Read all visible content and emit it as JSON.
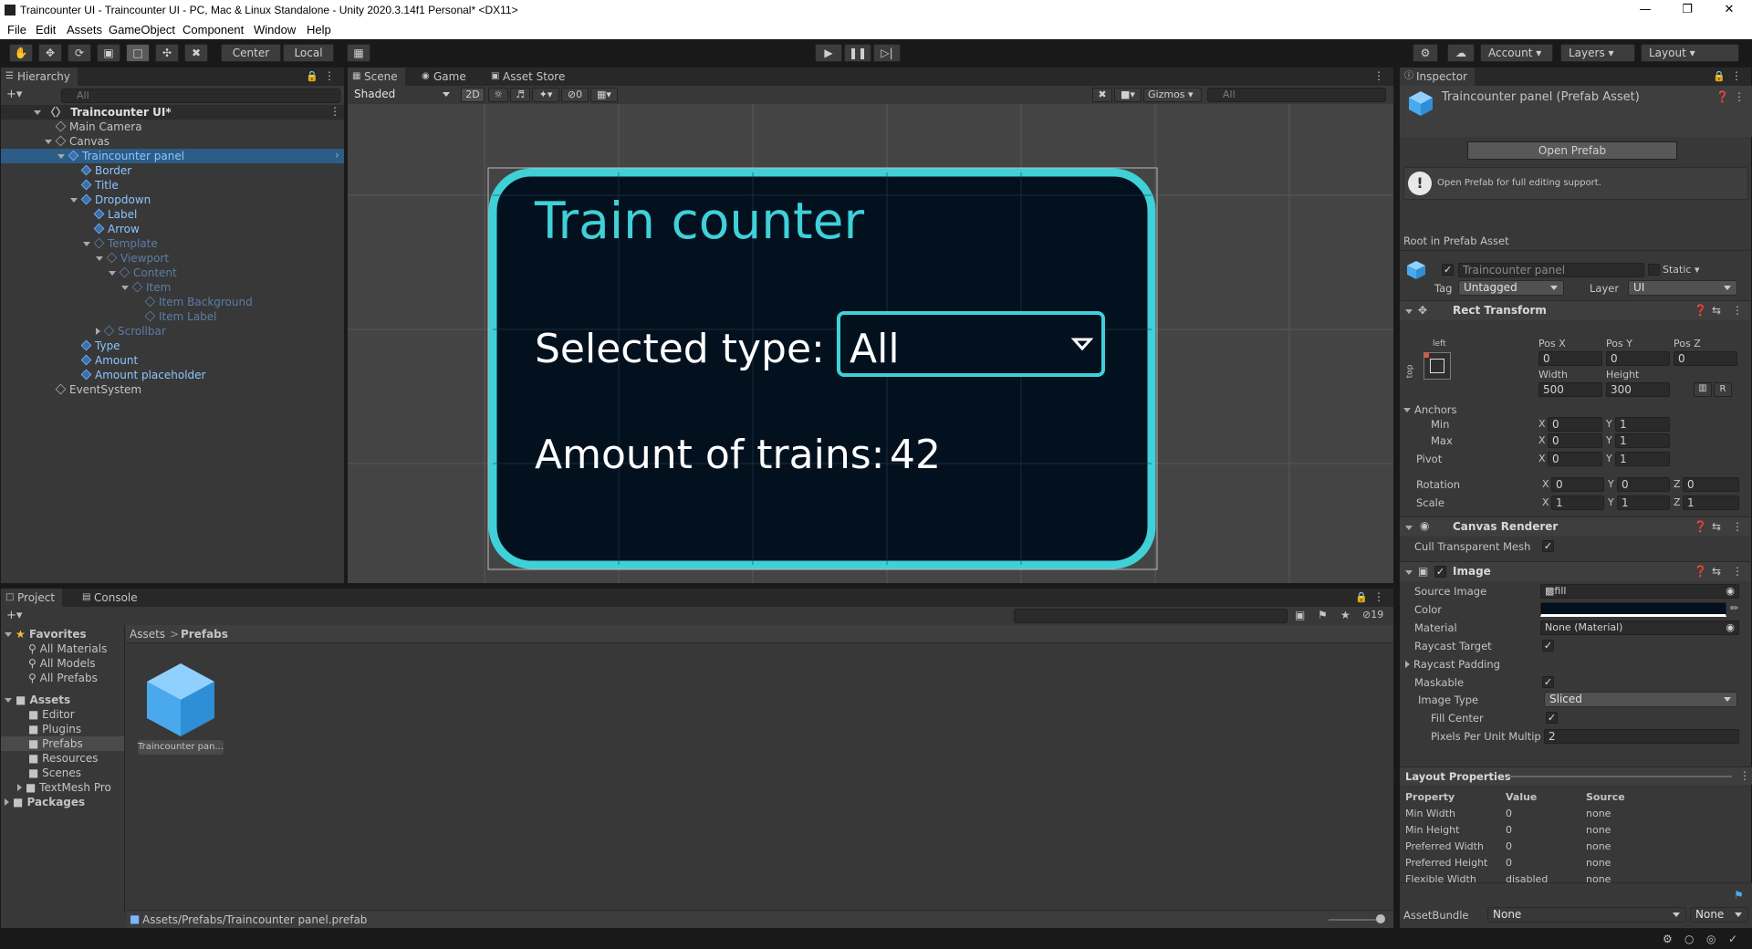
{
  "window": {
    "title": "Traincounter UI - Traincounter UI - PC, Mac & Linux Standalone - Unity 2020.3.14f1 Personal* <DX11>"
  },
  "menu": [
    "File",
    "Edit",
    "Assets",
    "GameObject",
    "Component",
    "Window",
    "Help"
  ],
  "toolbar": {
    "center": "Center",
    "local": "Local",
    "account": "Account",
    "layers": "Layers",
    "layout": "Layout"
  },
  "hierarchy": {
    "tab": "Hierarchy",
    "search_placeholder": "All",
    "items": [
      {
        "label": "Traincounter UI*"
      },
      {
        "label": "Main Camera"
      },
      {
        "label": "Canvas"
      },
      {
        "label": "Traincounter panel"
      },
      {
        "label": "Border"
      },
      {
        "label": "Title"
      },
      {
        "label": "Dropdown"
      },
      {
        "label": "Label"
      },
      {
        "label": "Arrow"
      },
      {
        "label": "Template"
      },
      {
        "label": "Viewport"
      },
      {
        "label": "Content"
      },
      {
        "label": "Item"
      },
      {
        "label": "Item Background"
      },
      {
        "label": "Item Label"
      },
      {
        "label": "Scrollbar"
      },
      {
        "label": "Type"
      },
      {
        "label": "Amount"
      },
      {
        "label": "Amount placeholder"
      },
      {
        "label": "EventSystem"
      }
    ]
  },
  "scene": {
    "tabs": [
      "Scene",
      "Game",
      "Asset Store"
    ],
    "shading": "Shaded",
    "mode2d": "2D",
    "hidden_count": "0",
    "gizmos": "Gizmos",
    "search_placeholder": "All",
    "panel": {
      "title": "Train counter",
      "selected_label": "Selected type:",
      "dropdown_value": "All",
      "amount_label": "Amount of trains:",
      "amount_value": "42",
      "accent": "#3fd0d8",
      "background": "#03111f"
    }
  },
  "project": {
    "tabs": [
      "Project",
      "Console"
    ],
    "hidden_count": "19",
    "favorites_label": "Favorites",
    "favorites": [
      "All Materials",
      "All Models",
      "All Prefabs"
    ],
    "assets_label": "Assets",
    "asset_folders": [
      "Editor",
      "Plugins",
      "Prefabs",
      "Resources",
      "Scenes",
      "TextMesh Pro"
    ],
    "packages_label": "Packages",
    "breadcrumb": [
      "Assets",
      "Prefabs"
    ],
    "file_label": "Traincounter pan...",
    "status_path": "Assets/Prefabs/Traincounter panel.prefab"
  },
  "inspector": {
    "tab": "Inspector",
    "asset_title": "Traincounter panel (Prefab Asset)",
    "open_prefab": "Open Prefab",
    "info": "Open Prefab for full editing support.",
    "root_label": "Root in Prefab Asset",
    "object_name": "Traincounter panel",
    "static_label": "Static",
    "tag_label": "Tag",
    "tag_value": "Untagged",
    "layer_label": "Layer",
    "layer_value": "UI",
    "rect": {
      "title": "Rect Transform",
      "anchor_h": "left",
      "anchor_v": "top",
      "posx_label": "Pos X",
      "posx": "0",
      "posy_label": "Pos Y",
      "posy": "0",
      "posz_label": "Pos Z",
      "posz": "0",
      "width_label": "Width",
      "width": "500",
      "height_label": "Height",
      "height": "300",
      "anchors_label": "Anchors",
      "min_label": "Min",
      "min_x": "0",
      "min_y": "1",
      "max_label": "Max",
      "max_x": "0",
      "max_y": "1",
      "pivot_label": "Pivot",
      "pivot_x": "0",
      "pivot_y": "1",
      "rotation_label": "Rotation",
      "rot_x": "0",
      "rot_y": "0",
      "rot_z": "0",
      "scale_label": "Scale",
      "scale_x": "1",
      "scale_y": "1",
      "scale_z": "1",
      "r_button": "R"
    },
    "canvas_renderer": {
      "title": "Canvas Renderer",
      "cull_label": "Cull Transparent Mesh"
    },
    "image": {
      "title": "Image",
      "source_label": "Source Image",
      "source_value": "fill",
      "color_label": "Color",
      "material_label": "Material",
      "material_value": "None (Material)",
      "raycast_target_label": "Raycast Target",
      "raycast_padding_label": "Raycast Padding",
      "maskable_label": "Maskable",
      "image_type_label": "Image Type",
      "image_type_value": "Sliced",
      "fill_center_label": "Fill Center",
      "ppu_label": "Pixels Per Unit Multip",
      "ppu_value": "2"
    },
    "layout_props": {
      "title": "Layout Properties",
      "headers": [
        "Property",
        "Value",
        "Source"
      ],
      "rows": [
        [
          "Min Width",
          "0",
          "none"
        ],
        [
          "Min Height",
          "0",
          "none"
        ],
        [
          "Preferred Width",
          "0",
          "none"
        ],
        [
          "Preferred Height",
          "0",
          "none"
        ],
        [
          "Flexible Width",
          "disabled",
          "none"
        ]
      ]
    },
    "assetbundle_label": "AssetBundle",
    "assetbundle_value": "None",
    "assetbundle_variant": "None"
  }
}
